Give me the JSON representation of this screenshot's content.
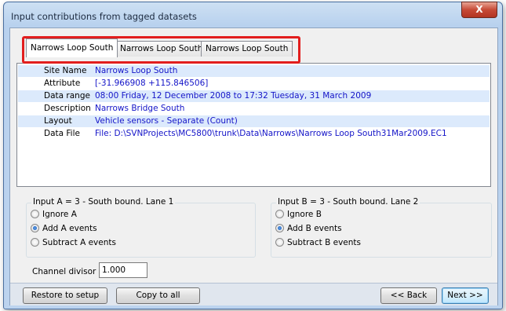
{
  "window": {
    "title": "Input contributions from tagged datasets",
    "close_label": "X"
  },
  "tabs": [
    {
      "label": "Narrows Loop South",
      "active": true
    },
    {
      "label": "Narrows Loop South",
      "active": false
    },
    {
      "label": "Narrows Loop South",
      "active": false
    }
  ],
  "info": [
    {
      "label": "Site Name",
      "value": "Narrows Loop South"
    },
    {
      "label": "Attribute",
      "value": "[-31.966908 +115.846506]"
    },
    {
      "label": "Data range",
      "value": "08:00 Friday, 12 December 2008 to 17:32 Tuesday, 31 March 2009"
    },
    {
      "label": "Description",
      "value": "Narrows Bridge South"
    },
    {
      "label": "Layout",
      "value": "Vehicle sensors - Separate (Count)"
    },
    {
      "label": "Data File",
      "value": "File: D:\\SVNProjects\\MC5800\\trunk\\Data\\Narrows\\Narrows Loop South31Mar2009.EC1"
    }
  ],
  "input_a": {
    "caption": "Input A = 3 - South bound. Lane 1",
    "options": [
      {
        "label": "Ignore A",
        "selected": false
      },
      {
        "label": "Add A events",
        "selected": true
      },
      {
        "label": "Subtract  A events",
        "selected": false
      }
    ]
  },
  "input_b": {
    "caption": "Input B = 3 - South bound. Lane 2",
    "options": [
      {
        "label": "Ignore B",
        "selected": false
      },
      {
        "label": "Add B events",
        "selected": true
      },
      {
        "label": "Subtract  B events",
        "selected": false
      }
    ]
  },
  "channel_divisor": {
    "label": "Channel divisor",
    "value": "1.000"
  },
  "buttons": {
    "restore": "Restore to setup",
    "copy_all": "Copy to all",
    "back": "<< Back",
    "next": "Next >>"
  },
  "colors": {
    "highlight": "#e21e1e",
    "value_text": "#1414c8",
    "row_alt": "#dceafc"
  }
}
